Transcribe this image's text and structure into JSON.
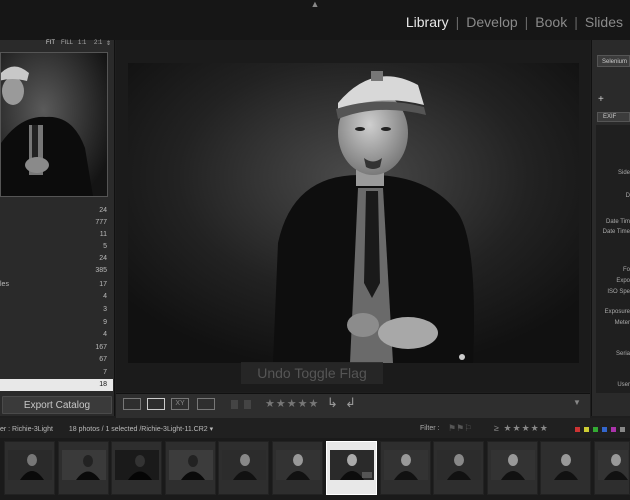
{
  "top_bar": {
    "modules": [
      "Library",
      "Develop",
      "Book",
      "Slides"
    ],
    "active_module": "Library",
    "collapse_icon": "triangle-up-icon"
  },
  "navigator": {
    "zoom_options": [
      "FIT",
      "FILL",
      "1:1",
      "2:1"
    ],
    "zoom_menu_icon": "updown-icon"
  },
  "left_panel": {
    "counts": [
      {
        "label": "",
        "count": "24"
      },
      {
        "label": "",
        "count": "777"
      },
      {
        "label": "",
        "count": "11"
      },
      {
        "label": "",
        "count": "5"
      },
      {
        "label": "",
        "count": "24"
      },
      {
        "label": "",
        "count": "385"
      },
      {
        "label": "les",
        "count": "17"
      },
      {
        "label": "",
        "count": "4"
      },
      {
        "label": "",
        "count": "3"
      },
      {
        "label": "",
        "count": "9"
      },
      {
        "label": "",
        "count": "4"
      },
      {
        "label": "",
        "count": "167"
      },
      {
        "label": "",
        "count": "67"
      },
      {
        "label": "",
        "count": "7"
      },
      {
        "label": "",
        "count": "18"
      }
    ],
    "export_button": "Export Catalog"
  },
  "center": {
    "toast": "Undo Toggle Flag",
    "stars": "★★★★★",
    "rotate_left_icon": "rotate-left-icon",
    "rotate_right_icon": "rotate-right-icon"
  },
  "right_panel": {
    "preset_value": "Selenium",
    "add_icon": "plus-icon",
    "metadata_set": "EXIF",
    "fields": [
      "Side",
      "D",
      "Date Tim",
      "Date Time",
      "Fo",
      "Expo",
      "ISO Spe",
      "Exposure",
      "Meter",
      "Seria",
      "User"
    ]
  },
  "filmstrip": {
    "source": "er : Richie-3Light",
    "count_text": "18 photos / 1 selected /",
    "filename": "Richie-3Light-11.CR2",
    "filter_label": "Filter :",
    "filter_stars": "≥ ★★★★★",
    "selected_index": 6
  },
  "colors": {
    "label_swatches": [
      "#c33",
      "#cc3",
      "#3a3",
      "#36c",
      "#a3a",
      "#888"
    ]
  }
}
